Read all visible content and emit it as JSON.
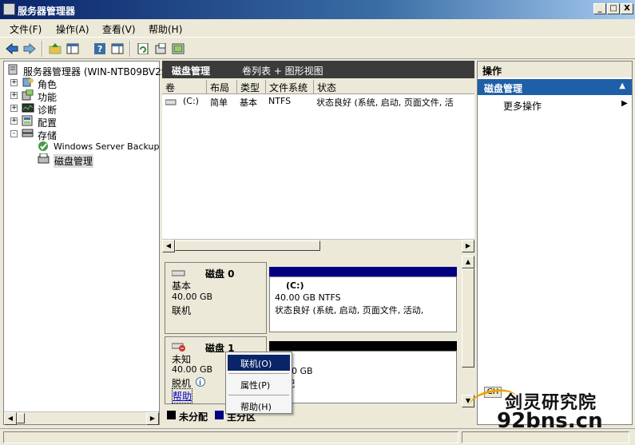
{
  "window": {
    "title": "服务器管理器",
    "controls": [
      "_",
      "□",
      "X"
    ]
  },
  "menu": [
    "文件(F)",
    "操作(A)",
    "查看(V)",
    "帮助(H)"
  ],
  "toolbar_icons": [
    "back-icon",
    "forward-icon",
    "up-folder-icon",
    "show-hide-tree-icon",
    "help-icon",
    "show-hide-action-icon",
    "refresh-icon",
    "properties-icon",
    "export-icon"
  ],
  "tree": {
    "root": "服务器管理器 (WIN-NTB09BV2SF",
    "items": [
      {
        "label": "角色",
        "expander": "+"
      },
      {
        "label": "功能",
        "expander": "+"
      },
      {
        "label": "诊断",
        "expander": "+"
      },
      {
        "label": "配置",
        "expander": "+"
      },
      {
        "label": "存储",
        "expander": "-"
      }
    ],
    "storage_children": [
      {
        "label": "Windows Server Backup"
      },
      {
        "label": "磁盘管理"
      }
    ]
  },
  "center": {
    "title": "磁盘管理",
    "view": "卷列表 + 图形视图",
    "columns": [
      "卷",
      "布局",
      "类型",
      "文件系统",
      "状态"
    ],
    "rows": [
      {
        "vol": "(C:)",
        "layout": "简单",
        "type": "基本",
        "fs": "NTFS",
        "status": "状态良好 (系统, 启动, 页面文件, 活"
      }
    ]
  },
  "disks": [
    {
      "name": "磁盘 0",
      "type": "基本",
      "size": "40.00 GB",
      "state": "联机",
      "volume": {
        "label": "(C:)",
        "size_fs": "40.00 GB NTFS",
        "status": "状态良好 (系统, 启动, 页面文件, 活动,"
      }
    },
    {
      "name": "磁盘 1",
      "type": "未知",
      "size": "40.00 GB",
      "state": "脱机",
      "help": "帮助",
      "volume": {
        "size_partial": "40 GB",
        "status_partial": "配"
      }
    }
  ],
  "context_menu": {
    "items": [
      "联机(O)",
      "属性(P)",
      "帮助(H)"
    ],
    "selected_index": 0
  },
  "legend": {
    "unallocated": "未分配",
    "primary": "主分区"
  },
  "actions": {
    "header": "操作",
    "section": "磁盘管理",
    "more": "更多操作"
  },
  "status_tag": "CH",
  "watermark": {
    "line1": "剑灵研究院",
    "line2": "92bns.cn"
  },
  "colors": {
    "primary_partition": "#000080",
    "unallocated": "#000000",
    "selection": "#0a246a",
    "action_header": "#1f5fa8"
  }
}
